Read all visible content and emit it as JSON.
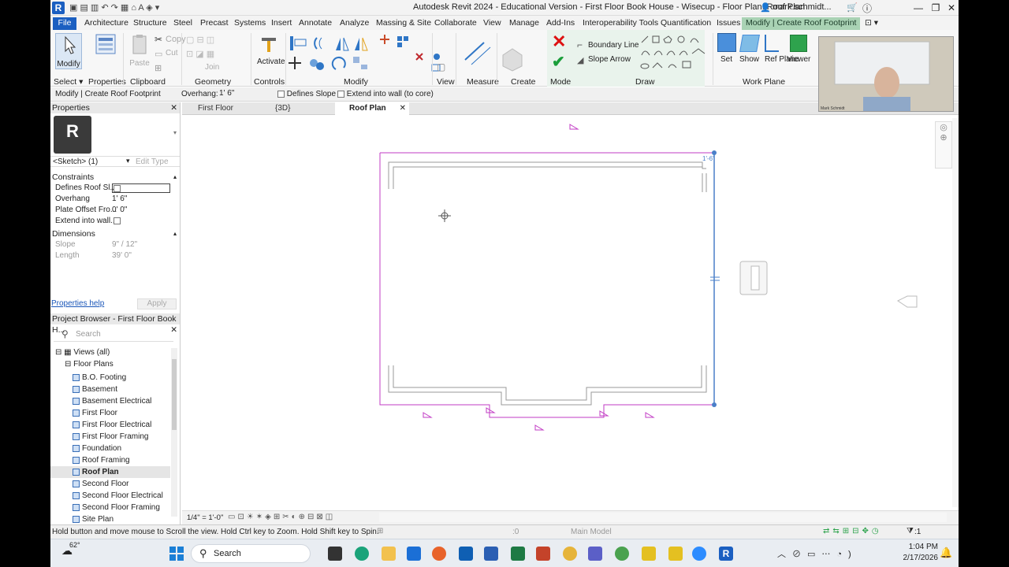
{
  "titlebar": {
    "title": "Autodesk Revit 2024 - Educational Version - First Floor Book House - Wisecup - Floor Plan: Roof Plan",
    "user": "mark.schmidt..."
  },
  "tabs": [
    "File",
    "Architecture",
    "Structure",
    "Steel",
    "Precast",
    "Systems",
    "Insert",
    "Annotate",
    "Analyze",
    "Massing & Site",
    "Collaborate",
    "View",
    "Manage",
    "Add-Ins",
    "Interoperability Tools",
    "Quantification",
    "Issues",
    "Modify | Create Roof Footprint"
  ],
  "ribbon": {
    "panels": [
      "Select",
      "Properties",
      "Clipboard",
      "Geometry",
      "Controls",
      "Modify",
      "View",
      "Measure",
      "Create",
      "Mode",
      "Draw",
      "Work Plane"
    ],
    "modify_label": "Modify",
    "activate_label": "Activate",
    "paste_label": "Paste",
    "boundary_line": "Boundary Line",
    "slope_arrow": "Slope Arrow",
    "set_label": "Set",
    "show_label": "Show",
    "ref_plane_label": "Ref Plane",
    "viewer_label": "Viewer",
    "copy_label": "Copy",
    "cut_label": "Cut",
    "join_label": "Join"
  },
  "optionsbar": {
    "context": "Modify | Create Roof Footprint",
    "overhang_label": "Overhang:",
    "overhang_value": "1'  6\"",
    "defines_slope": "Defines Slope",
    "extend_core": "Extend into wall (to core)"
  },
  "properties": {
    "header": "Properties",
    "type_selector": "<Sketch> (1)",
    "edit_type": "Edit Type",
    "section_constraints": "Constraints",
    "rows": [
      {
        "label": "Defines Roof Sl...",
        "value": ""
      },
      {
        "label": "Overhang",
        "value": "1'  6\""
      },
      {
        "label": "Plate Offset Fro...",
        "value": "0'  0\""
      },
      {
        "label": "Extend into wall...",
        "value": ""
      }
    ],
    "section_dimensions": "Dimensions",
    "dim_rows": [
      {
        "label": "Slope",
        "value": "9\" / 12\""
      },
      {
        "label": "Length",
        "value": "39'  0\""
      }
    ],
    "help": "Properties help",
    "apply": "Apply"
  },
  "browser": {
    "header": "Project Browser - First Floor Book H...",
    "search_placeholder": "Search",
    "views_all": "Views (all)",
    "floor_plans": "Floor Plans",
    "items": [
      "B.O. Footing",
      "Basement",
      "Basement Electrical",
      "First Floor",
      "First Floor Electrical",
      "First Floor Framing",
      "Foundation",
      "Roof Framing",
      "Roof Plan",
      "Second Floor",
      "Second Floor Electrical",
      "Second Floor Framing",
      "Site Plan"
    ],
    "selected": "Roof Plan"
  },
  "viewtabs": [
    "First Floor",
    "{3D}",
    "Roof Plan"
  ],
  "viewcontrol": {
    "scale": "1/4\" = 1'-0\""
  },
  "status": {
    "hint": "Hold button and move mouse to Scroll the view. Hold Ctrl key to Zoom. Hold Shift key to Spin.",
    "model": "Main Model",
    "zero": ":0",
    "filter": ":1"
  },
  "canvas": {
    "dim_text": "1'-6\""
  },
  "webcam": {
    "name": "Mark Schmidt"
  },
  "taskbar": {
    "search": "Search",
    "weather": "62°",
    "time": "1:04 PM",
    "date": "2/17/2026"
  },
  "colors": {
    "accent": "#1b5fc1",
    "sketch": "#c23bc4",
    "context_tab": "#a9d2b4"
  }
}
